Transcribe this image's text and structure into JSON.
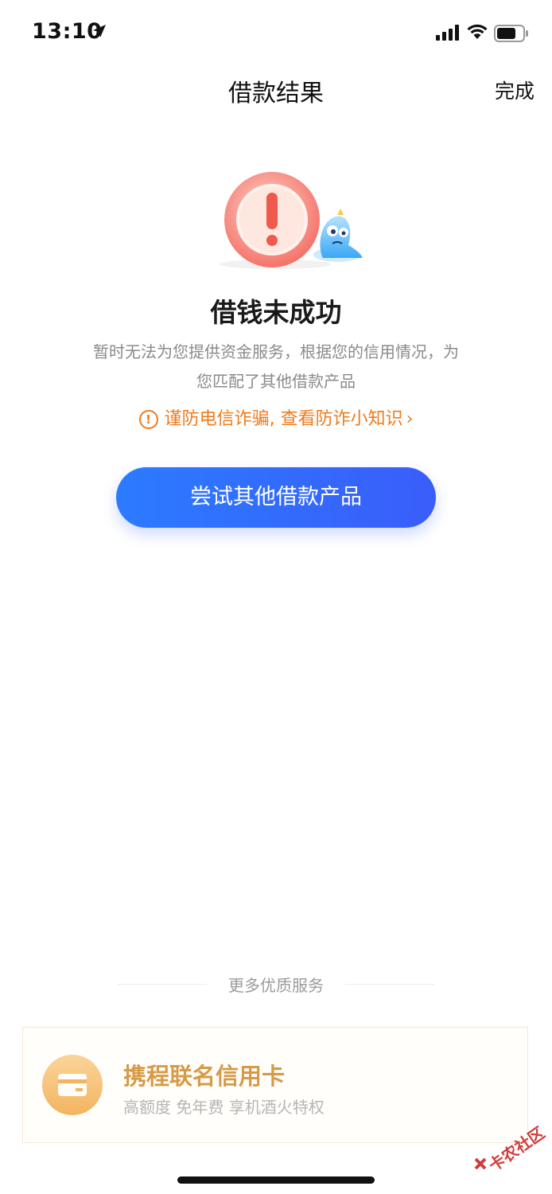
{
  "status_bar": {
    "time": "13:10"
  },
  "nav": {
    "title": "借款结果",
    "done_label": "完成"
  },
  "result": {
    "illustration_icon": "warning-circle-with-mascot",
    "title": "借钱未成功",
    "description": "暂时无法为您提供资金服务，根据您的信用情况，为您匹配了其他借款产品",
    "fraud_tip": "谨防电信诈骗, 查看防诈小知识"
  },
  "primary_button": {
    "label": "尝试其他借款产品"
  },
  "more_services": {
    "label": "更多优质服务"
  },
  "service_card": {
    "icon": "credit-card-icon",
    "title": "携程联名信用卡",
    "subtitle": "高额度 免年费 享机酒火特权"
  },
  "watermark": {
    "text": "卡农社区"
  },
  "colors": {
    "primary": "#2b7bff",
    "warning": "#f07a1a",
    "card_accent": "#d79a45"
  }
}
